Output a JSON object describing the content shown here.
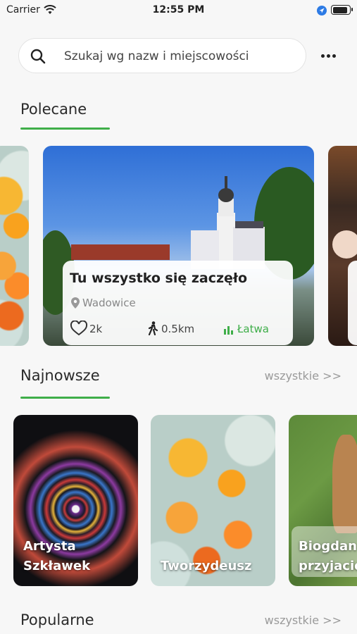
{
  "status_bar": {
    "carrier": "Carrier",
    "time": "12:55 PM",
    "battery_level": 0.95
  },
  "search": {
    "placeholder": "Szukaj wg nazw i miejscowości"
  },
  "sections": {
    "recommended": {
      "title": "Polecane",
      "featured": {
        "title": "Tu wszystko się zaczęło",
        "place": "Wadowice",
        "likes": "2k",
        "distance": "0.5km",
        "difficulty": "Łatwa"
      }
    },
    "newest": {
      "title": "Najnowsze",
      "see_all": "wszystkie >>",
      "items": [
        {
          "line1": "Artysta",
          "line2": "Szkławek"
        },
        {
          "line1": "Tworzydeusz"
        },
        {
          "line1": "Biogdan",
          "line2": "przyjaciel"
        }
      ]
    },
    "popular": {
      "title": "Popularne",
      "see_all": "wszystkie >>"
    }
  },
  "colors": {
    "accent": "#3fae49",
    "muted": "#9a9a9a",
    "background": "#f7f7f7"
  },
  "icons": [
    "wifi-icon",
    "location-arrow-icon",
    "battery-icon",
    "search-icon",
    "more-icon",
    "pin-icon",
    "heart-icon",
    "walking-icon",
    "difficulty-bars-icon"
  ]
}
